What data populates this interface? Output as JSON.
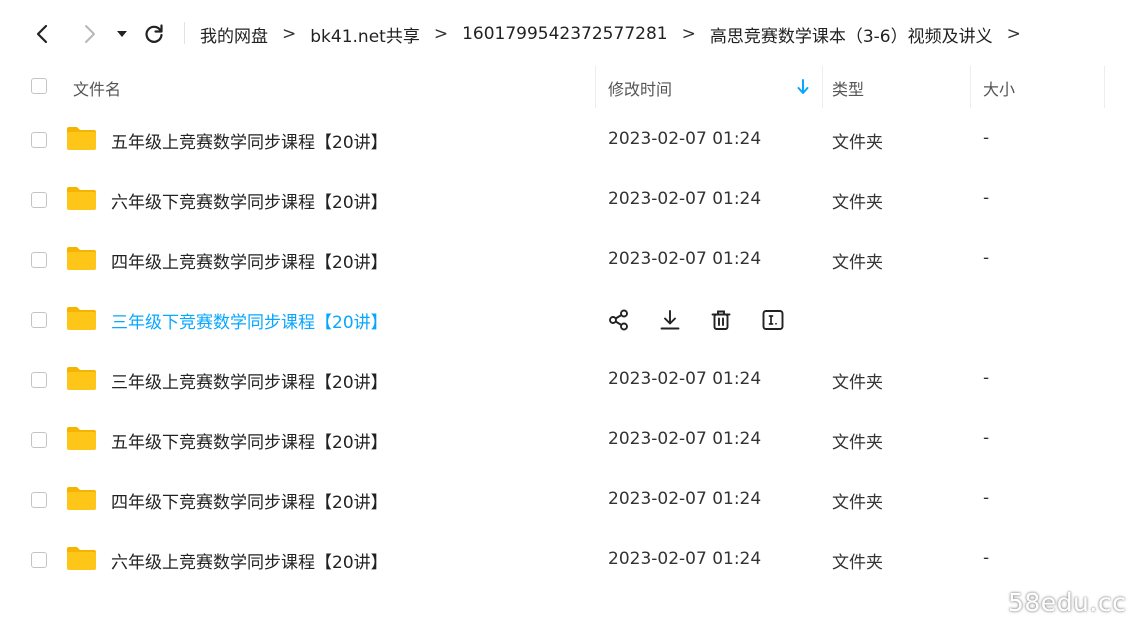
{
  "breadcrumb": {
    "items": [
      "我的网盘",
      "bk41.net共享",
      "1601799542372577281",
      "高思竞赛数学课本（3-6）视频及讲义"
    ],
    "separator": ">"
  },
  "columns": {
    "name": "文件名",
    "modified": "修改时间",
    "type": "类型",
    "size": "大小"
  },
  "files": [
    {
      "name": "五年级上竞赛数学同步课程【20讲】",
      "modified": "2023-02-07 01:24",
      "type": "文件夹",
      "size": "-"
    },
    {
      "name": "六年级下竞赛数学同步课程【20讲】",
      "modified": "2023-02-07 01:24",
      "type": "文件夹",
      "size": "-"
    },
    {
      "name": "四年级上竞赛数学同步课程【20讲】",
      "modified": "2023-02-07 01:24",
      "type": "文件夹",
      "size": "-"
    },
    {
      "name": "三年级下竞赛数学同步课程【20讲】",
      "hovered": true
    },
    {
      "name": "三年级上竞赛数学同步课程【20讲】",
      "modified": "2023-02-07 01:24",
      "type": "文件夹",
      "size": "-"
    },
    {
      "name": "五年级下竞赛数学同步课程【20讲】",
      "modified": "2023-02-07 01:24",
      "type": "文件夹",
      "size": "-"
    },
    {
      "name": "四年级下竞赛数学同步课程【20讲】",
      "modified": "2023-02-07 01:24",
      "type": "文件夹",
      "size": "-"
    },
    {
      "name": "六年级上竞赛数学同步课程【20讲】",
      "modified": "2023-02-07 01:24",
      "type": "文件夹",
      "size": "-"
    }
  ],
  "hover_actions": [
    "share-icon",
    "download-icon",
    "delete-icon",
    "rename-icon"
  ],
  "watermark": "58edu.cc",
  "colors": {
    "accent": "#06a7ff",
    "folder": "#ffc61a",
    "folder_tab": "#f6b400"
  }
}
